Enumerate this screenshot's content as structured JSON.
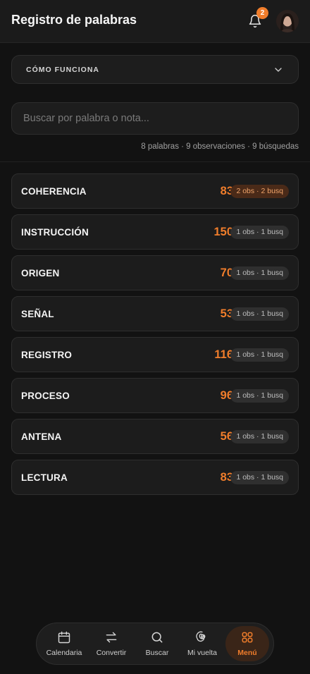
{
  "header": {
    "title": "Registro de palabras",
    "notifications_count": "2",
    "bell_icon": "bell-icon",
    "avatar_icon": "user-avatar"
  },
  "howto": {
    "label": "CÓMO FUNCIONA",
    "icon": "chevron-down-icon"
  },
  "search": {
    "placeholder": "Buscar por palabra o nota...",
    "value": ""
  },
  "stats": "8 palabras · 9 observaciones · 9 búsquedas",
  "words": [
    {
      "word": "COHERENCIA",
      "count": "83",
      "meta": "2 obs · 2 busq",
      "highlight": true
    },
    {
      "word": "INSTRUCCIÓN",
      "count": "150",
      "meta": "1 obs · 1 busq",
      "highlight": false
    },
    {
      "word": "ORIGEN",
      "count": "70",
      "meta": "1 obs · 1 busq",
      "highlight": false
    },
    {
      "word": "SEÑAL",
      "count": "53",
      "meta": "1 obs · 1 busq",
      "highlight": false
    },
    {
      "word": "REGISTRO",
      "count": "116",
      "meta": "1 obs · 1 busq",
      "highlight": false
    },
    {
      "word": "PROCESO",
      "count": "96",
      "meta": "1 obs · 1 busq",
      "highlight": false
    },
    {
      "word": "ANTENA",
      "count": "56",
      "meta": "1 obs · 1 busq",
      "highlight": false
    },
    {
      "word": "LECTURA",
      "count": "83",
      "meta": "1 obs · 1 busq",
      "highlight": false
    }
  ],
  "nav": [
    {
      "label": "Calendaria",
      "icon": "calendar-icon",
      "active": false
    },
    {
      "label": "Convertir",
      "icon": "swap-arrows-icon",
      "active": false
    },
    {
      "label": "Buscar",
      "icon": "search-icon",
      "active": false
    },
    {
      "label": "Mi vuelta",
      "icon": "spiral-icon",
      "active": false
    },
    {
      "label": "Menú",
      "icon": "grid-icon",
      "active": true
    }
  ],
  "colors": {
    "accent": "#f07d2b",
    "background": "#121212",
    "card": "#1c1c1c"
  }
}
